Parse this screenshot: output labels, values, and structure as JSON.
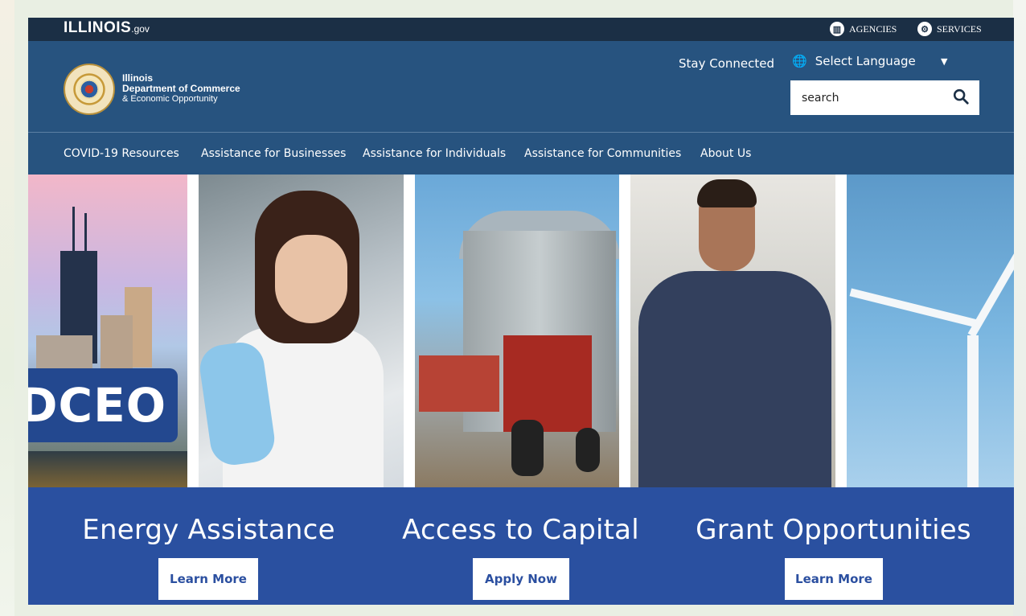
{
  "topbar": {
    "brand_main": "ILLINOIS",
    "brand_suffix": ".gov",
    "agencies": "AGENCIES",
    "services": "SERVICES"
  },
  "header": {
    "org_line1": "Illinois",
    "org_line2": "Department of Commerce",
    "org_line3": "& Economic Opportunity",
    "stay_connected": "Stay Connected",
    "select_language": "Select Language",
    "search_placeholder": "search"
  },
  "nav": {
    "items": [
      {
        "label": "COVID-19 Resources"
      },
      {
        "label": "Assistance for Businesses"
      },
      {
        "label": "Assistance for Individuals"
      },
      {
        "label": "Assistance for Communities"
      },
      {
        "label": "About Us"
      }
    ]
  },
  "hero": {
    "dceo_label": "DCEO"
  },
  "cta": [
    {
      "title": "Energy Assistance",
      "button": "Learn More"
    },
    {
      "title": "Access to Capital",
      "button": "Apply Now"
    },
    {
      "title": "Grant Opportunities",
      "button": "Learn More"
    }
  ],
  "colors": {
    "topbar": "#1b2f45",
    "header": "#27537f",
    "cta_band": "#2a50a0",
    "button_text": "#2b4fa0"
  },
  "icons": {
    "agencies": "building-icon",
    "services": "gears-icon",
    "language": "globe-icon",
    "caret": "caret-down-icon",
    "search": "magnifier-icon",
    "chat": "chat-widget-icon"
  }
}
